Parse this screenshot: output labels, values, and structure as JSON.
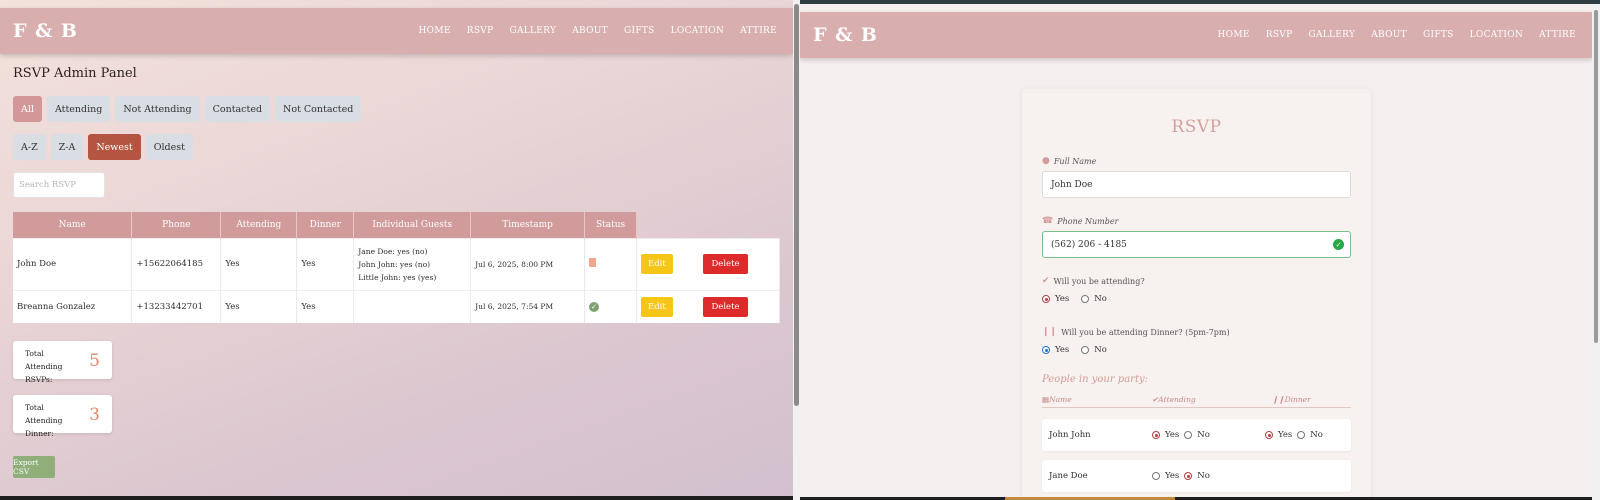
{
  "brand": "F & B",
  "nav": [
    "HOME",
    "RSVP",
    "GALLERY",
    "ABOUT",
    "GIFTS",
    "LOCATION",
    "ATTIRE"
  ],
  "admin": {
    "title": "RSVP Admin Panel",
    "filters": [
      "All",
      "Attending",
      "Not Attending",
      "Contacted",
      "Not Contacted"
    ],
    "sorts": [
      "A-Z",
      "Z-A",
      "Newest",
      "Oldest"
    ],
    "search_placeholder": "Search RSVP",
    "columns": [
      "Name",
      "Phone",
      "Attending",
      "Dinner",
      "Individual Guests",
      "Timestamp",
      "Status"
    ],
    "rows": [
      {
        "name": "John Doe",
        "phone": "+15622064185",
        "attending": "Yes",
        "dinner": "Yes",
        "guests": [
          "Jane Doe: yes (no)",
          "John John: yes (no)",
          "Little John: yes (yes)"
        ],
        "timestamp": "Jul 6, 2025, 8:00 PM",
        "status": "pending"
      },
      {
        "name": "Breanna Gonzalez",
        "phone": "+13233442701",
        "attending": "Yes",
        "dinner": "Yes",
        "guests": [],
        "timestamp": "Jul 6, 2025, 7:54 PM",
        "status": "contacted"
      }
    ],
    "edit_label": "Edit",
    "delete_label": "Delete",
    "stats": [
      {
        "label": "Total Attending RSVPs:",
        "value": "5"
      },
      {
        "label": "Total Attending Dinner:",
        "value": "3"
      }
    ],
    "export_label": "Export CSV"
  },
  "form": {
    "title": "RSVP",
    "full_name_label": "Full Name",
    "full_name_value": "John Doe",
    "phone_label": "Phone Number",
    "phone_value": "(562) 206 - 4185",
    "attending_q": "Will you be attending?",
    "dinner_q": "Will you be attending Dinner? (5pm-7pm)",
    "yes": "Yes",
    "no": "No",
    "attending_answer": "Yes",
    "dinner_answer": "Yes",
    "party_title": "People in your party:",
    "party_headers": [
      "Name",
      "Attending",
      "Dinner"
    ],
    "party": [
      {
        "name": "John John",
        "attending": "Yes",
        "dinner": "Yes"
      },
      {
        "name": "Jane Doe",
        "attending": "No",
        "dinner": null
      }
    ]
  },
  "colors": {
    "navbar": "#d9aeae",
    "table_header": "#d29b9b",
    "active_filter": "#d3979a",
    "active_sort": "#b35540",
    "edit": "#f5c518",
    "delete": "#dd2b2b",
    "export": "#8fae7a",
    "stat_value": "#e0876c"
  }
}
